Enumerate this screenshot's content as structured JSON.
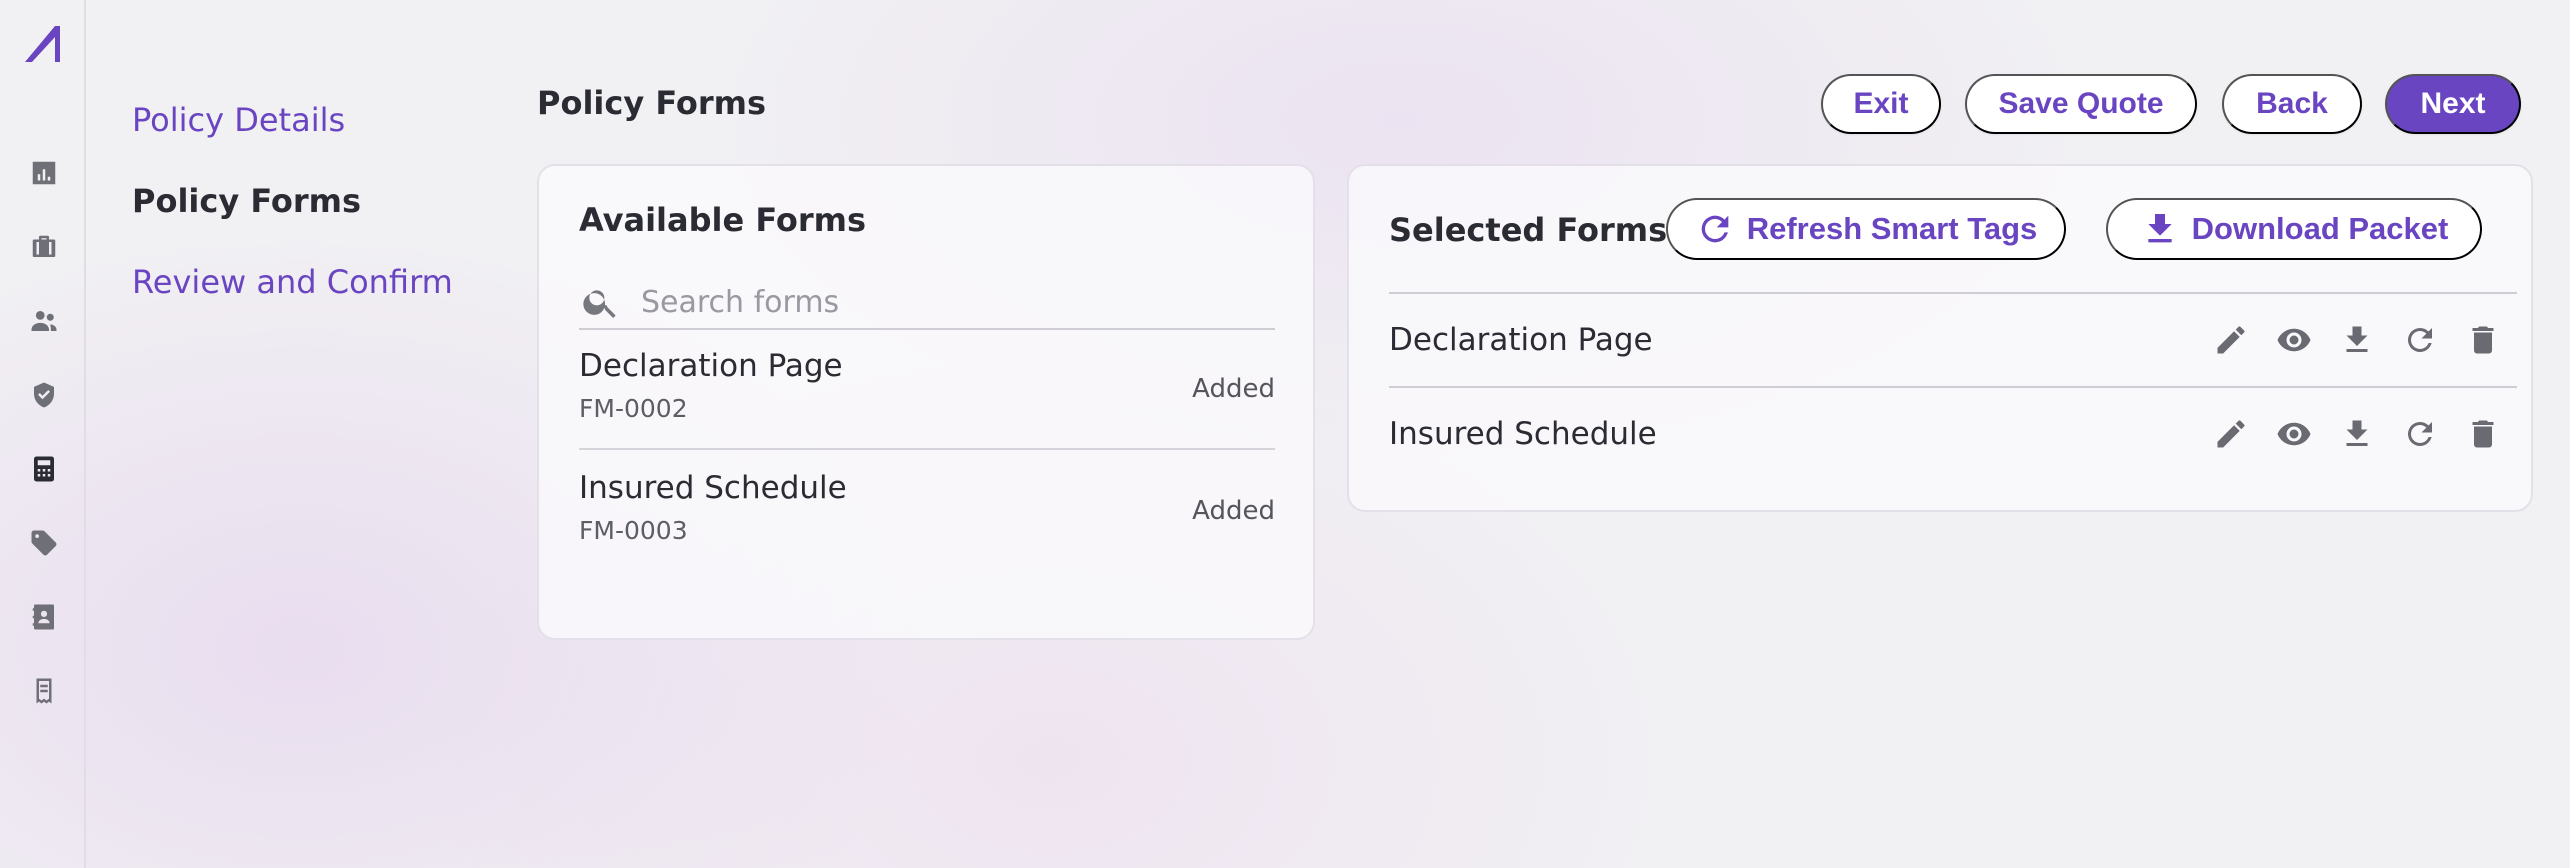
{
  "rail": {
    "logo": "brand-logo",
    "icons": [
      "bar-chart-icon",
      "briefcase-icon",
      "people-icon",
      "shield-check-icon",
      "calculator-icon",
      "tag-icon",
      "contact-book-icon",
      "receipt-icon"
    ]
  },
  "steps": [
    {
      "label": "Policy Details",
      "active": false
    },
    {
      "label": "Policy Forms",
      "active": true
    },
    {
      "label": "Review and Confirm",
      "active": false
    }
  ],
  "header": {
    "title": "Policy Forms",
    "exit_label": "Exit",
    "save_quote_label": "Save Quote",
    "back_label": "Back",
    "next_label": "Next"
  },
  "available": {
    "title": "Available Forms",
    "search_placeholder": "Search forms",
    "search_value": "",
    "items": [
      {
        "name": "Declaration Page",
        "code": "FM-0002",
        "status": "Added"
      },
      {
        "name": "Insured Schedule",
        "code": "FM-0003",
        "status": "Added"
      }
    ]
  },
  "selected": {
    "title": "Selected Forms",
    "refresh_label": "Refresh Smart Tags",
    "download_label": "Download Packet",
    "items": [
      {
        "name": "Declaration Page",
        "actions": [
          "edit-icon",
          "view-icon",
          "download-icon",
          "refresh-icon",
          "delete-icon"
        ]
      },
      {
        "name": "Insured Schedule",
        "actions": [
          "edit-icon",
          "view-icon",
          "download-icon",
          "refresh-icon",
          "delete-icon"
        ]
      }
    ]
  },
  "colors": {
    "accent": "#6a45c2",
    "background": "#f1f0f3",
    "text": "#2b2b33",
    "icon": "#6f6f78"
  }
}
